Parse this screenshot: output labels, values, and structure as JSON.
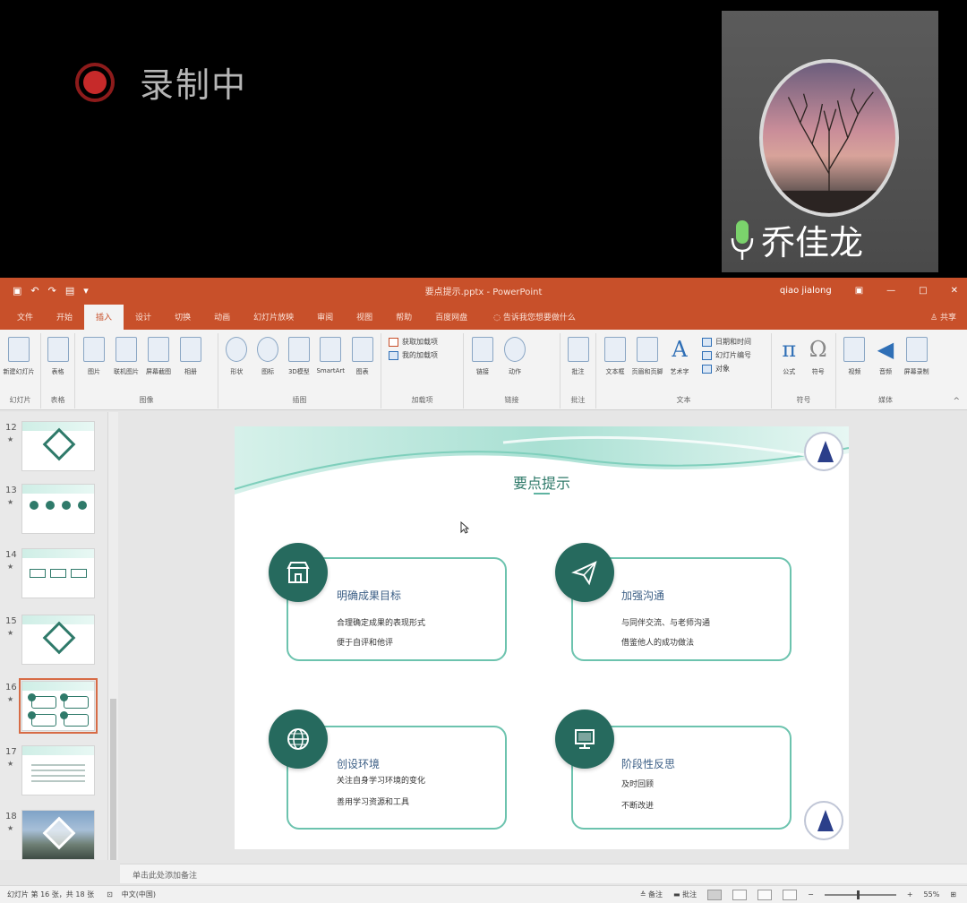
{
  "recording": {
    "label": "录制中"
  },
  "camera": {
    "user_name": "乔佳龙"
  },
  "titlebar": {
    "document_title": "要点提示.pptx - PowerPoint",
    "user": "qiao jialong"
  },
  "tabs": [
    {
      "label": "文件"
    },
    {
      "label": "开始"
    },
    {
      "label": "插入"
    },
    {
      "label": "设计"
    },
    {
      "label": "切换"
    },
    {
      "label": "动画"
    },
    {
      "label": "幻灯片放映"
    },
    {
      "label": "审阅"
    },
    {
      "label": "视图"
    },
    {
      "label": "帮助"
    },
    {
      "label": "百度网盘"
    }
  ],
  "active_tab": "插入",
  "tell_me": "告诉我您想要做什么",
  "share": "共享",
  "ribbon": {
    "groups": [
      {
        "label": "幻灯片",
        "buttons": [
          "新建幻灯片"
        ]
      },
      {
        "label": "表格",
        "buttons": [
          "表格"
        ]
      },
      {
        "label": "图像",
        "buttons": [
          "图片",
          "联机图片",
          "屏幕截图",
          "相册"
        ]
      },
      {
        "label": "插图",
        "buttons": [
          "形状",
          "图标",
          "3D模型",
          "SmartArt",
          "图表"
        ]
      },
      {
        "label": "加载项",
        "small": [
          "获取加载项",
          "我的加载项"
        ]
      },
      {
        "label": "链接",
        "buttons": [
          "链接",
          "动作"
        ]
      },
      {
        "label": "批注",
        "buttons": [
          "批注"
        ]
      },
      {
        "label": "文本",
        "buttons": [
          "文本框",
          "页眉和页脚",
          "艺术字"
        ],
        "small": [
          "日期和时间",
          "幻灯片编号",
          "对象"
        ]
      },
      {
        "label": "符号",
        "buttons": [
          "公式",
          "符号"
        ]
      },
      {
        "label": "媒体",
        "buttons": [
          "视频",
          "音频",
          "屏幕录制"
        ]
      }
    ]
  },
  "thumbnails": [
    {
      "num": "12",
      "kind": "diamond"
    },
    {
      "num": "13",
      "kind": "dots"
    },
    {
      "num": "14",
      "kind": "boxes"
    },
    {
      "num": "15",
      "kind": "diamond"
    },
    {
      "num": "16",
      "kind": "cards",
      "selected": true
    },
    {
      "num": "17",
      "kind": "lines"
    },
    {
      "num": "18",
      "kind": "photo"
    }
  ],
  "slide": {
    "title": "要点提示",
    "cards": [
      {
        "title": "明确成果目标",
        "lines": [
          "合理确定成果的表现形式",
          "便于自评和他评"
        ],
        "icon": "shop-icon"
      },
      {
        "title": "加强沟通",
        "lines": [
          "与同伴交流、与老师沟通",
          "借鉴他人的成功做法"
        ],
        "icon": "paper-plane-icon"
      },
      {
        "title": "创设环境",
        "lines": [
          "关注自身学习环境的变化",
          "善用学习资源和工具"
        ],
        "icon": "globe-icon"
      },
      {
        "title": "阶段性反思",
        "lines": [
          "及时回顾",
          "不断改进"
        ],
        "icon": "monitor-icon"
      }
    ]
  },
  "notes_placeholder": "单击此处添加备注",
  "status": {
    "slide_info": "幻灯片 第 16 张，共 18 张",
    "language": "中文(中国)",
    "notes_btn": "备注",
    "comments_btn": "批注",
    "zoom": "55%"
  },
  "colors": {
    "ppt_orange": "#c8502a",
    "teal_dark": "#266a5e",
    "teal_light": "#6cc3ae"
  }
}
